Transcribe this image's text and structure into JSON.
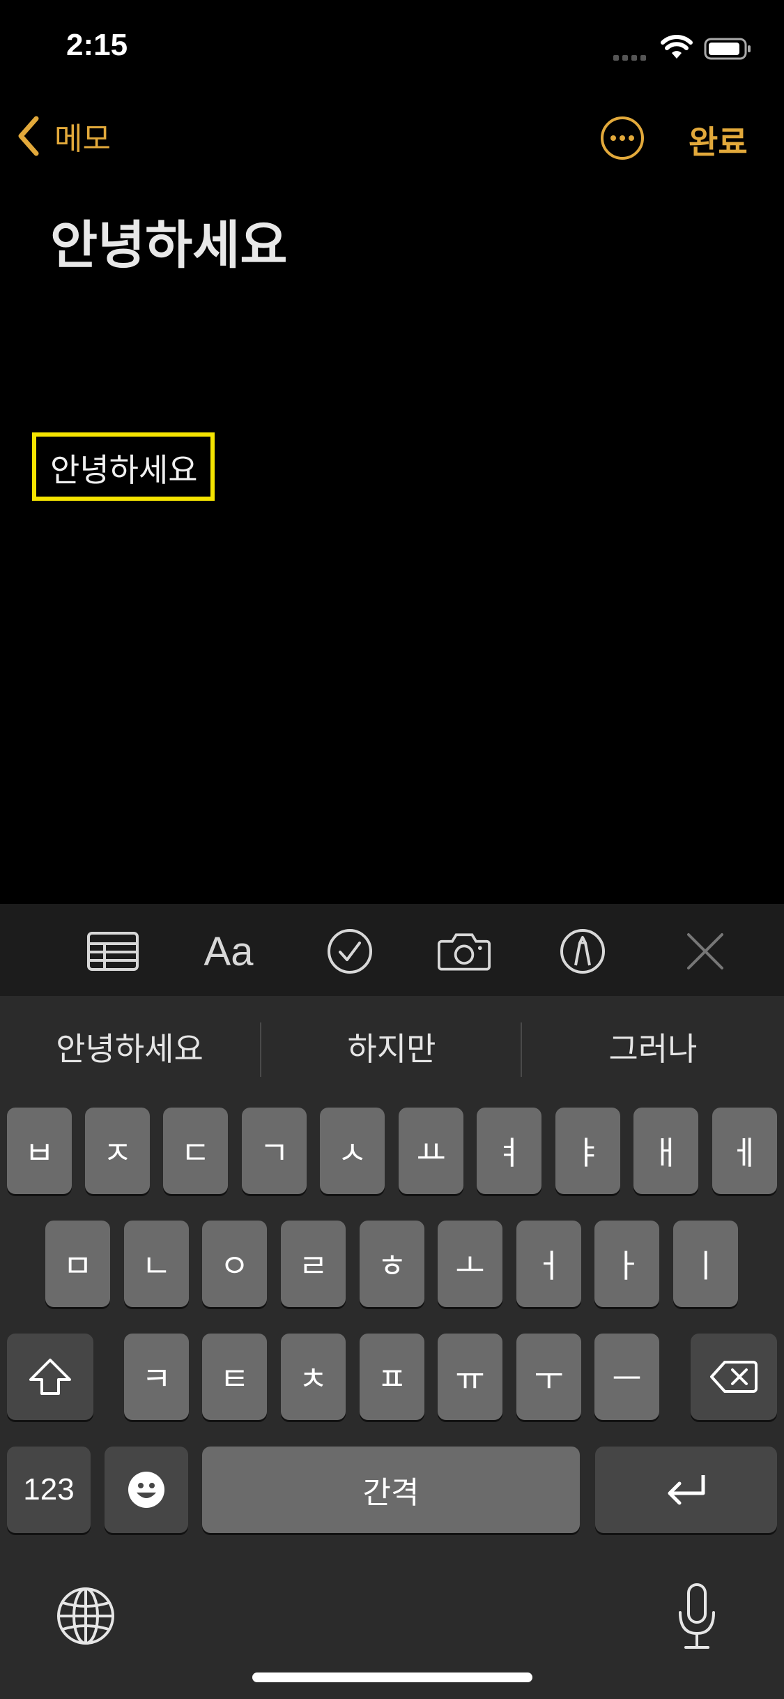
{
  "status_bar": {
    "time": "2:15"
  },
  "nav": {
    "back_label": "메모",
    "done_label": "완료"
  },
  "note": {
    "title": "안녕하세요",
    "body": "안녕하세요"
  },
  "toolbar": {
    "icons": [
      "table-icon",
      "Aa",
      "checklist-icon",
      "camera-icon",
      "markup-icon",
      "close-icon"
    ],
    "format_label": "Aa"
  },
  "keyboard": {
    "suggestions": [
      "안녕하세요",
      "하지만",
      "그러나"
    ],
    "row1": [
      "ㅂ",
      "ㅈ",
      "ㄷ",
      "ㄱ",
      "ㅅ",
      "ㅛ",
      "ㅕ",
      "ㅑ",
      "ㅐ",
      "ㅔ"
    ],
    "row2": [
      "ㅁ",
      "ㄴ",
      "ㅇ",
      "ㄹ",
      "ㅎ",
      "ㅗ",
      "ㅓ",
      "ㅏ",
      "ㅣ"
    ],
    "row3": [
      "ㅋ",
      "ㅌ",
      "ㅊ",
      "ㅍ",
      "ㅠ",
      "ㅜ",
      "ㅡ"
    ],
    "numbers_label": "123",
    "space_label": "간격"
  },
  "colors": {
    "accent": "#e2a93b",
    "highlight": "#f5e400"
  }
}
